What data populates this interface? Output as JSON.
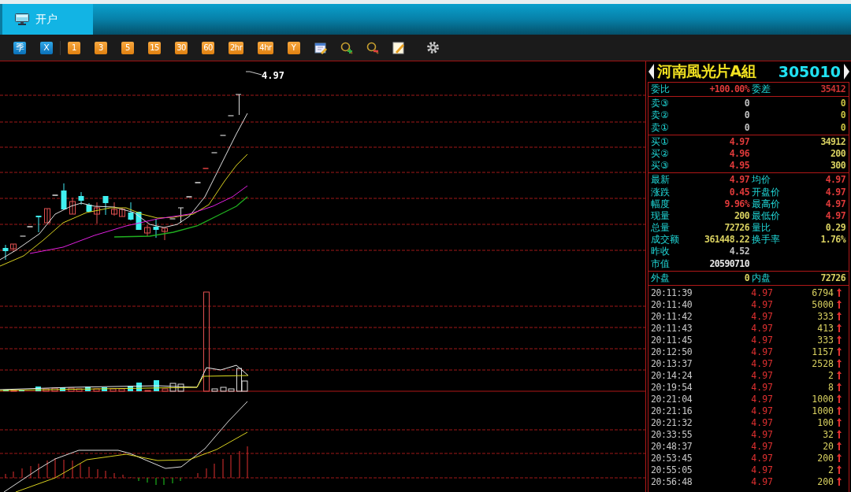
{
  "tabs": [
    {
      "label": "开户",
      "selected": true
    }
  ],
  "toolbar": [
    {
      "kind": "blue",
      "label": "季"
    },
    {
      "kind": "blue",
      "label": "X"
    },
    {
      "kind": "separator"
    },
    {
      "kind": "orange",
      "label": "1"
    },
    {
      "kind": "orange",
      "label": "3"
    },
    {
      "kind": "orange",
      "label": "5"
    },
    {
      "kind": "orange",
      "label": "15"
    },
    {
      "kind": "orange",
      "label": "30"
    },
    {
      "kind": "orange",
      "label": "60"
    },
    {
      "kind": "orange",
      "label": "2hr"
    },
    {
      "kind": "orange",
      "label": "4hr"
    },
    {
      "kind": "orange",
      "label": "Y"
    },
    {
      "kind": "calendar"
    },
    {
      "kind": "zoom_in"
    },
    {
      "kind": "zoom_out"
    },
    {
      "kind": "note"
    },
    {
      "kind": "settings"
    }
  ],
  "chart": {
    "price_label": "4.97"
  },
  "quote": {
    "name": "河南風光片A組",
    "code": "305010",
    "sections": [
      {
        "rows": [
          {
            "cells": [
              {
                "label": "委比",
                "value": "+100.00%",
                "color": "#e03a3a"
              },
              {
                "label": "委差",
                "value": "35412",
                "color": "#c83232"
              }
            ]
          }
        ]
      },
      {
        "rows": [
          {
            "cells": [
              {
                "label": "卖③",
                "value": "0",
                "color": "#c0c0c0"
              },
              {
                "value": "0",
                "color": "#c8c040"
              }
            ]
          },
          {
            "cells": [
              {
                "label": "卖②",
                "value": "0",
                "color": "#c0c0c0"
              },
              {
                "value": "0",
                "color": "#c8c040"
              }
            ]
          },
          {
            "cells": [
              {
                "label": "卖①",
                "value": "0",
                "color": "#c0c0c0"
              },
              {
                "value": "0",
                "color": "#c8c040"
              }
            ]
          }
        ]
      },
      {
        "rows": [
          {
            "cells": [
              {
                "label": "买①",
                "value": "4.97",
                "color": "#e03a3a"
              },
              {
                "value": "34912",
                "color": "#d8d060"
              }
            ]
          },
          {
            "cells": [
              {
                "label": "买②",
                "value": "4.96",
                "color": "#e03a3a"
              },
              {
                "value": "200",
                "color": "#d8d060"
              }
            ]
          },
          {
            "cells": [
              {
                "label": "买③",
                "value": "4.95",
                "color": "#e03a3a"
              },
              {
                "value": "300",
                "color": "#d8d060"
              }
            ]
          }
        ]
      },
      {
        "rows": [
          {
            "cells": [
              {
                "label": "最新",
                "value": "4.97",
                "color": "#e03a3a"
              },
              {
                "label": "均价",
                "value": "4.97",
                "color": "#e03a3a"
              }
            ]
          },
          {
            "cells": [
              {
                "label": "涨跌",
                "value": "0.45",
                "color": "#e03a3a"
              },
              {
                "label": "开盘价",
                "value": "4.97",
                "color": "#e03a3a"
              }
            ]
          },
          {
            "cells": [
              {
                "label": "幅度",
                "value": "9.96%",
                "color": "#e03a3a"
              },
              {
                "label": "最高价",
                "value": "4.97",
                "color": "#e03a3a"
              }
            ]
          },
          {
            "cells": [
              {
                "label": "现量",
                "value": "200",
                "color": "#d8d060"
              },
              {
                "label": "最低价",
                "value": "4.97",
                "color": "#e03a3a"
              }
            ]
          },
          {
            "cells": [
              {
                "label": "总量",
                "value": "72726",
                "color": "#d8d060"
              },
              {
                "label": "量比",
                "value": "0.29",
                "color": "#d8d060"
              }
            ]
          },
          {
            "cells": [
              {
                "label": "成交额",
                "value": "361448.22",
                "color": "#d8d060"
              },
              {
                "label": "换手率",
                "value": "1.76%",
                "color": "#d8d060"
              }
            ]
          },
          {
            "cells": [
              {
                "label": "昨收",
                "value": "4.52",
                "color": "#c0c0c0"
              }
            ]
          },
          {
            "cells": [
              {
                "label": "市值",
                "value": "20590710",
                "color": "#e8e8e8"
              }
            ]
          }
        ]
      },
      {
        "rows": [
          {
            "cells": [
              {
                "label": "外盘",
                "value": "0",
                "color": "#d8d060"
              },
              {
                "label": "内盘",
                "value": "72726",
                "color": "#d8d060"
              }
            ]
          }
        ]
      }
    ],
    "ticks": [
      {
        "time": "20:11:39",
        "price": "4.97",
        "volume": "6794"
      },
      {
        "time": "20:11:40",
        "price": "4.97",
        "volume": "5000"
      },
      {
        "time": "20:11:42",
        "price": "4.97",
        "volume": "333"
      },
      {
        "time": "20:11:43",
        "price": "4.97",
        "volume": "413"
      },
      {
        "time": "20:11:45",
        "price": "4.97",
        "volume": "333"
      },
      {
        "time": "20:12:50",
        "price": "4.97",
        "volume": "1157"
      },
      {
        "time": "20:13:37",
        "price": "4.97",
        "volume": "2528"
      },
      {
        "time": "20:14:24",
        "price": "4.97",
        "volume": "2"
      },
      {
        "time": "20:19:54",
        "price": "4.97",
        "volume": "8"
      },
      {
        "time": "20:21:04",
        "price": "4.97",
        "volume": "1000"
      },
      {
        "time": "20:21:16",
        "price": "4.97",
        "volume": "1000"
      },
      {
        "time": "20:21:32",
        "price": "4.97",
        "volume": "100"
      },
      {
        "time": "20:33:55",
        "price": "4.97",
        "volume": "32"
      },
      {
        "time": "20:48:37",
        "price": "4.97",
        "volume": "20"
      },
      {
        "time": "20:53:45",
        "price": "4.97",
        "volume": "200"
      },
      {
        "time": "20:55:05",
        "price": "4.97",
        "volume": "2"
      },
      {
        "time": "20:56:48",
        "price": "4.97",
        "volume": "200"
      }
    ]
  }
}
